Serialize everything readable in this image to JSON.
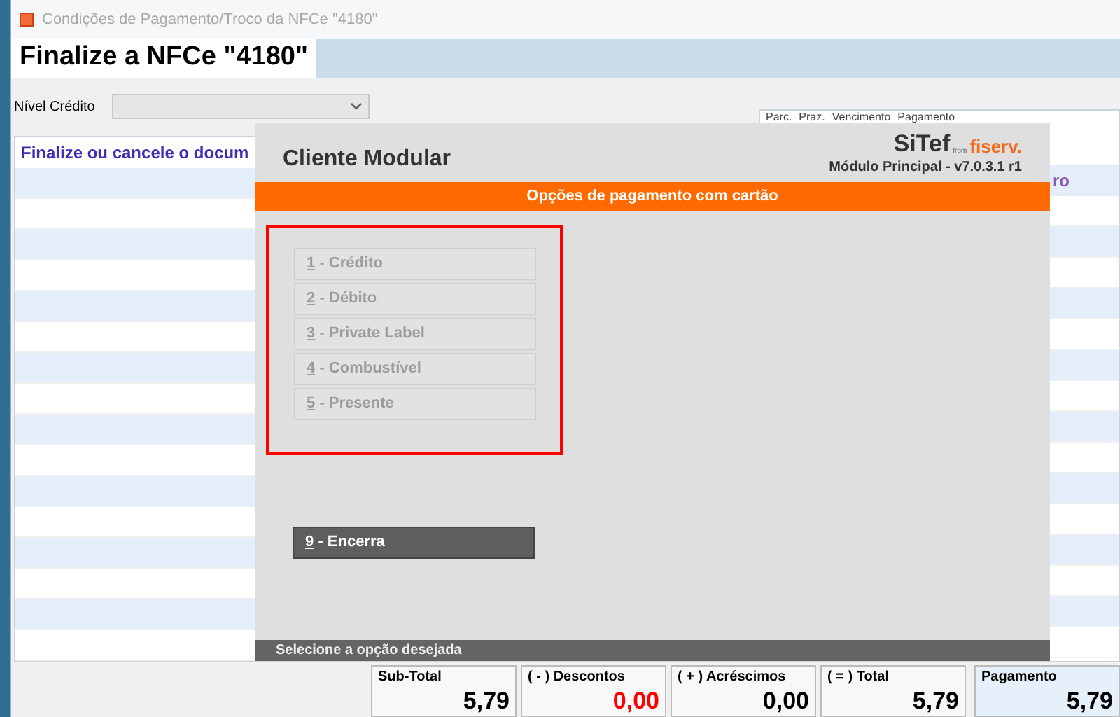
{
  "window": {
    "title": "Condições de Pagamento/Troco da NFCe \"4180\""
  },
  "tab": {
    "label": "Finalize a NFCe \"4180\"",
    "selected": true
  },
  "credit_level": {
    "label": "Nível Crédito"
  },
  "message_table": {
    "message": "Finalize ou cancele o docum"
  },
  "payments_table": {
    "columns": [
      "Parc.",
      "Praz.",
      "Vencimento",
      "Pagamento"
    ],
    "row_text": "ro"
  },
  "modal": {
    "title": "Cliente Modular",
    "logo": {
      "brand": "SiTef",
      "from": "from",
      "partner": "fiserv."
    },
    "version": "Módulo Principal - v7.0.3.1 r1",
    "section_title": "Opções de pagamento com cartão",
    "options": [
      {
        "hotkey": "1",
        "label": "- Crédito",
        "disabled": true
      },
      {
        "hotkey": "2",
        "label": "- Débito",
        "disabled": true
      },
      {
        "hotkey": "3",
        "label": "- Private Label",
        "disabled": true
      },
      {
        "hotkey": "4",
        "label": "- Combustível",
        "disabled": true
      },
      {
        "hotkey": "5",
        "label": "- Presente",
        "disabled": true
      }
    ],
    "close_button": {
      "hotkey": "9",
      "label": "- Encerra",
      "disabled": false
    },
    "status": "Selecione a opção desejada"
  },
  "totals": [
    {
      "label": "Sub-Total",
      "value": "5,79",
      "color": "#000000",
      "selected": false
    },
    {
      "label": "( - ) Descontos",
      "value": "0,00",
      "color": "#ff0000",
      "selected": false
    },
    {
      "label": "( + ) Acréscimos",
      "value": "0,00",
      "color": "#000000",
      "selected": false
    },
    {
      "label": "( = ) Total",
      "value": "5,79",
      "color": "#000000",
      "selected": false
    },
    {
      "label": "Pagamento",
      "value": "5,79",
      "color": "#000000",
      "selected": true
    }
  ]
}
